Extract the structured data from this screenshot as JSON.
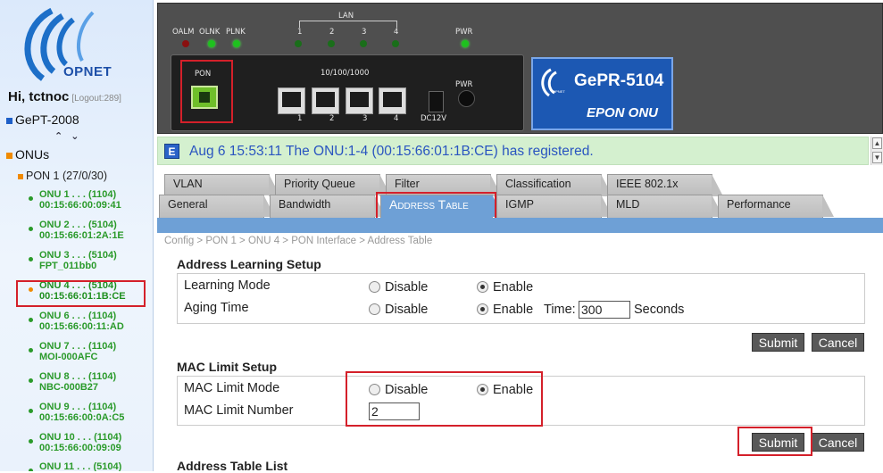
{
  "sidebar": {
    "greeting": "Hi, tctnoc",
    "logout": "[Logout:289]",
    "olt_name": "GePT-2008",
    "collapse_glyph": "⌃ ⌄",
    "onus_title": "ONUs",
    "pon_label": "PON 1 (27/0/30)",
    "onus": [
      {
        "line1": "ONU 1 . . . (1104)",
        "line2": "00:15:66:00:09:41"
      },
      {
        "line1": "ONU 2 . . . (5104)",
        "line2": "00:15:66:01:2A:1E"
      },
      {
        "line1": "ONU 3 . . . (5104)",
        "line2": "FPT_011bb0"
      },
      {
        "line1": "ONU 4 . . . (5104)",
        "line2": "00:15:66:01:1B:CE"
      },
      {
        "line1": "ONU 6 . . . (1104)",
        "line2": "00:15:66:00:11:AD"
      },
      {
        "line1": "ONU 7 . . . (1104)",
        "line2": "MOI-000AFC"
      },
      {
        "line1": "ONU 8 . . . (1104)",
        "line2": "NBC-000B27"
      },
      {
        "line1": "ONU 9 . . . (1104)",
        "line2": "00:15:66:00:0A:C5"
      },
      {
        "line1": "ONU 10 . . . (1104)",
        "line2": "00:15:66:00:09:09"
      },
      {
        "line1": "ONU 11 . . . (5104)",
        "line2": ""
      }
    ],
    "logo_text": "OPNET"
  },
  "device": {
    "led_labels": {
      "oalm": "OALM",
      "olnk": "OLNK",
      "plnk": "PLNK",
      "lan": "LAN",
      "pwr": "PWR"
    },
    "lan_numbers": [
      "1",
      "2",
      "3",
      "4"
    ],
    "pon_label": "PON",
    "port_speed": "10/100/1000",
    "port_numbers": [
      "1",
      "2",
      "3",
      "4"
    ],
    "dc_label": "DC12V",
    "pwr_label": "PWR",
    "model": "GePR-5104",
    "model_sub": "EPON ONU",
    "brand_small": "OPNET"
  },
  "notification": {
    "icon": "E",
    "text": "Aug 6 15:53:11  The ONU:1-4 (00:15:66:01:1B:CE) has registered."
  },
  "tabs_row1": [
    "VLAN",
    "Priority Queue",
    "Filter",
    "Classification",
    "IEEE 802.1x"
  ],
  "tabs_row2": [
    "General",
    "Bandwidth",
    "Address Table",
    "IGMP",
    "MLD",
    "Performance"
  ],
  "breadcrumb": "Config > PON 1 > ONU 4 > PON Interface > Address Table",
  "address_learning": {
    "title": "Address Learning Setup",
    "learning_mode_label": "Learning Mode",
    "aging_time_label": "Aging Time",
    "disable_label": "Disable",
    "enable_label": "Enable",
    "time_label": "Time:",
    "time_value": "300",
    "seconds_label": "Seconds"
  },
  "mac_limit": {
    "title": "MAC Limit Setup",
    "mode_label": "MAC Limit Mode",
    "number_label": "MAC Limit Number",
    "disable_label": "Disable",
    "enable_label": "Enable",
    "number_value": "2"
  },
  "buttons": {
    "submit": "Submit",
    "cancel": "Cancel"
  },
  "address_table_list_title": "Address Table List"
}
